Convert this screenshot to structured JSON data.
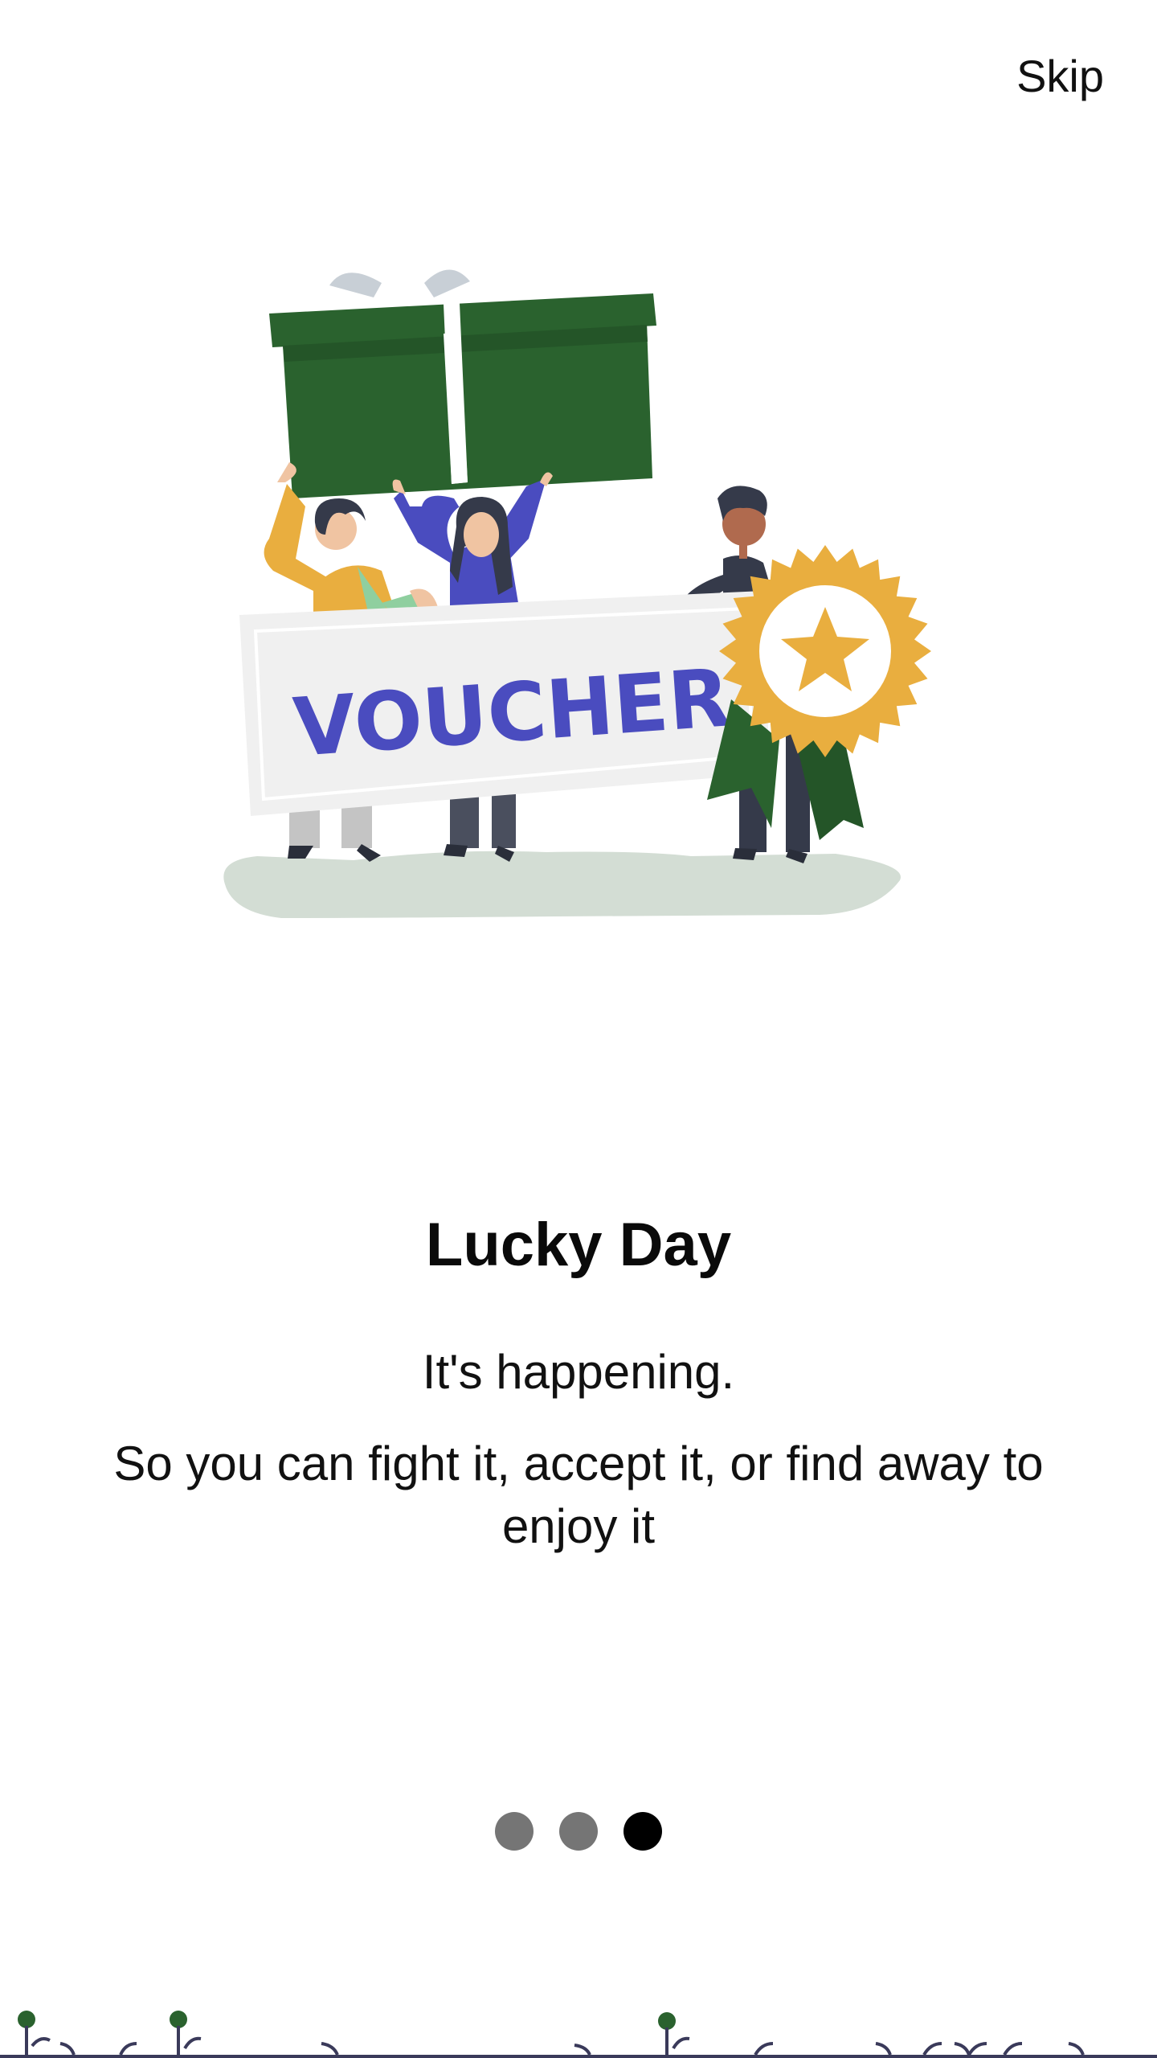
{
  "header": {
    "skip_label": "Skip"
  },
  "illustration": {
    "banner_text": "VOUCHER"
  },
  "slide": {
    "title": "Lucky Day",
    "subtitle": "It's happening.",
    "body": "So you can fight it, accept it, or find away to enjoy it"
  },
  "pager": {
    "total": 3,
    "active_index": 2
  },
  "colors": {
    "gift_green": "#2a622e",
    "ribbon_gray": "#c8cfd6",
    "purple": "#4a4cbf",
    "gold": "#e9ae3f",
    "dark_navy": "#353a4a",
    "ground": "#d3ddd4",
    "dot_inactive": "#757575",
    "dot_active": "#000000"
  }
}
